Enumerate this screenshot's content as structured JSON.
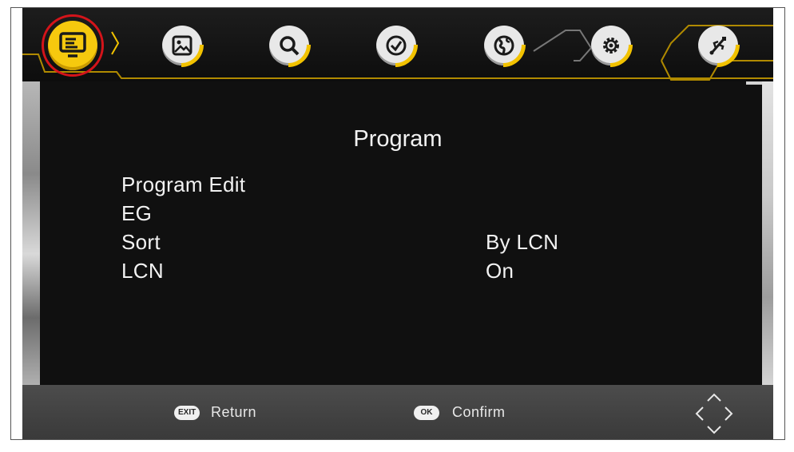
{
  "topbar": {
    "tabs": [
      {
        "icon": "tv-program-icon",
        "active": true
      },
      {
        "icon": "picture-icon",
        "active": false
      },
      {
        "icon": "search-channel-icon",
        "active": false
      },
      {
        "icon": "time-clock-icon",
        "active": false
      },
      {
        "icon": "globe-language-icon",
        "active": false
      },
      {
        "icon": "gear-setup-icon",
        "active": false
      },
      {
        "icon": "usb-icon",
        "active": false
      }
    ],
    "accent_color": "#f2c200",
    "highlight_color": "#d4141a"
  },
  "menu": {
    "title": "Program",
    "items": [
      {
        "label": "Program Edit",
        "value": ""
      },
      {
        "label": "EG",
        "value": ""
      },
      {
        "label": "Sort",
        "value": "By LCN"
      },
      {
        "label": "LCN",
        "value": "On"
      }
    ]
  },
  "helpbar": {
    "exit_key": "EXIT",
    "exit_label": "Return",
    "ok_key": "OK",
    "ok_label": "Confirm",
    "nav_icon": "dpad-arrows-icon"
  }
}
